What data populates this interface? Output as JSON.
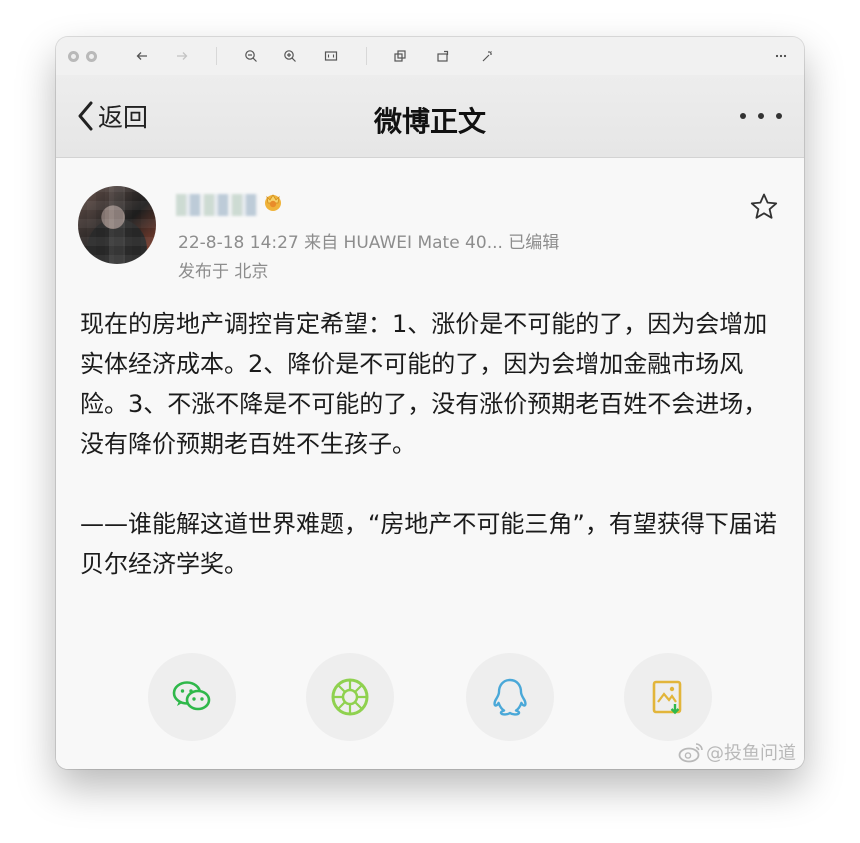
{
  "viewer": {
    "toolbar": {
      "icons": [
        "back-arrow-icon",
        "forward-arrow-icon",
        "zoom-out-icon",
        "zoom-in-icon",
        "fit-icon",
        "crop-icon",
        "rotate-icon",
        "magic-wand-icon",
        "more-icon"
      ]
    }
  },
  "navbar": {
    "back_label": "返回",
    "title": "微博正文"
  },
  "post": {
    "timestamp_source": "22-8-18 14:27  来自 HUAWEI Mate 40...  已编辑",
    "location": "发布于 北京",
    "paragraph1": "现在的房地产调控肯定希望：1、涨价是不可能的了，因为会增加实体经济成本。2、降价是不可能的了，因为会增加金融市场风险。3、不涨不降是不可能的了，没有涨价预期老百姓不会进场，没有降价预期老百姓不生孩子。",
    "paragraph2": "——谁能解这道世界难题，“房地产不可能三角”，有望获得下届诺贝尔经济学奖。"
  },
  "share": [
    "wechat-icon",
    "moments-icon",
    "qq-icon",
    "save-image-icon"
  ],
  "watermark": {
    "text": "@投鱼问道"
  },
  "colors": {
    "wechat": "#2fb84a",
    "moments": "#8fd14f",
    "qq": "#4aa8d8",
    "save": "#e2b53a",
    "meta_text": "#8d8d8d"
  }
}
